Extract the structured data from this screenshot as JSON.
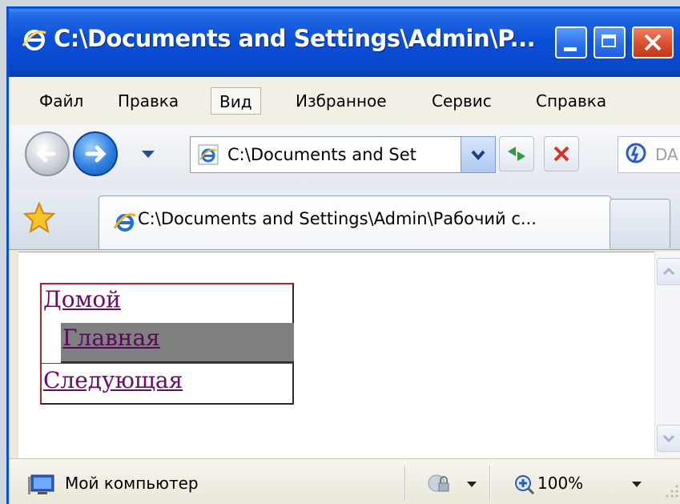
{
  "window": {
    "title": "C:\\Documents and Settings\\Admin\\P..."
  },
  "menu": {
    "items": [
      "Файл",
      "Правка",
      "Вид",
      "Избранное",
      "Сервис",
      "Справка"
    ],
    "active_index": 2
  },
  "navbar": {
    "address": "C:\\Documents and Set",
    "search_placeholder": "DA"
  },
  "tab": {
    "title": "C:\\Documents and Settings\\Admin\\Рабочий с..."
  },
  "content": {
    "links": {
      "home": "Домой",
      "main": "Главная",
      "next": "Следующая"
    },
    "colors": {
      "link": "#6a0a6a",
      "highlight_bg": "#808080",
      "border": "#b3232b"
    }
  },
  "status": {
    "zone": "Мой компьютер",
    "zoom": "100%"
  }
}
